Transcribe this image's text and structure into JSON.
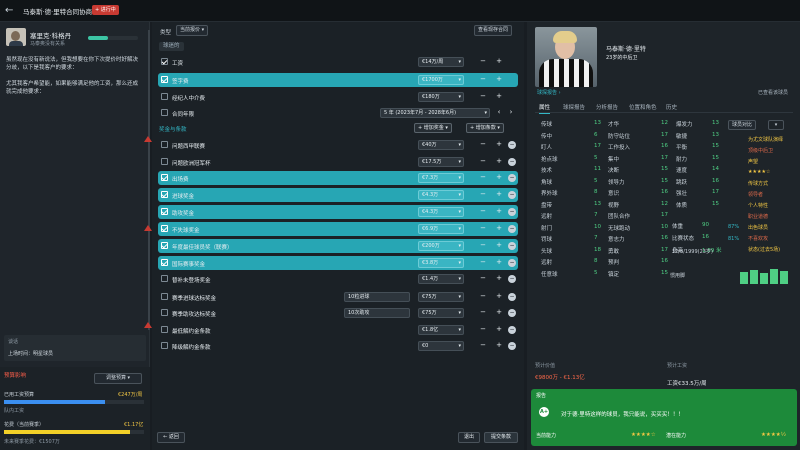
{
  "header": {
    "title": "马泰斯·德·里特合同协商",
    "badge": "+ 进行中"
  },
  "agent": {
    "name": "塞里克·科格丹",
    "subtitle": "马泰奥没有关系",
    "message1": "虽然现在没有新说法，但我想要在你下次提价时好解决分歧，以下是我客户的要求：",
    "message2": "尤其我客户希望能，如果能够满足他的工资，那么还成就完成他要求：",
    "box_title": "谈话",
    "box_text": "上场时间：明星球员"
  },
  "budget": {
    "title": "预算影响",
    "adjust_label": "调整预算",
    "wage_label": "已用工资预算",
    "wage_value": "€247万/周",
    "wage_sub": "队内工资",
    "wage_fill": 0.72,
    "spend_label": "花费（当前赛季）",
    "spend_value": "€1.17亿",
    "spend_sub": "未来赛季花费：€1507万",
    "spend_fill": 0.9
  },
  "center": {
    "type_label": "类型",
    "type_value": "当前报价",
    "view_btn": "查看现存合同",
    "status": "球迷的",
    "bonus_section": "奖金与条款",
    "add_bonus": "增加奖金",
    "add_clause": "增加条款",
    "rows": [
      {
        "label": "工资",
        "value": "€14万/周",
        "hl": false,
        "checked": true
      },
      {
        "label": "签字费",
        "value": "€1700万",
        "hl": true,
        "checked": true
      },
      {
        "label": "经纪人中介费",
        "value": "€180万",
        "hl": false,
        "checked": false
      },
      {
        "label": "合同年限",
        "value": "5 年 (2023年7月 - 2028年6月)",
        "hl": false,
        "checked": false
      },
      {
        "label": "问题西甲联赛",
        "value": "€40万",
        "hl": false,
        "checked": false
      },
      {
        "label": "问题欧洲冠军杯",
        "value": "€17.5万",
        "hl": false,
        "checked": false
      },
      {
        "label": "出场费",
        "value": "€7.3万",
        "hl": true,
        "checked": true
      },
      {
        "label": "进球奖金",
        "value": "€4.3万",
        "hl": true,
        "checked": true
      },
      {
        "label": "助攻奖金",
        "value": "€4.3万",
        "hl": true,
        "checked": true
      },
      {
        "label": "不失球奖金",
        "value": "€6.9万",
        "hl": true,
        "checked": true
      },
      {
        "label": "年度最佳球员奖（联赛）",
        "value": "€200万",
        "hl": true,
        "checked": true
      },
      {
        "label": "国际赛事奖金",
        "value": "€3.8万",
        "hl": true,
        "checked": true
      },
      {
        "label": "替补未登场奖金",
        "value": "€1.4万",
        "hl": false,
        "checked": false
      },
      {
        "label": "赛季进球达标奖金",
        "value": "€75万",
        "hl": false,
        "checked": false,
        "cond": "10粒进球"
      },
      {
        "label": "赛季助攻达标奖金",
        "value": "€75万",
        "hl": false,
        "checked": false,
        "cond": "10次助攻"
      },
      {
        "label": "最低解约金条款",
        "value": "€1.8亿",
        "hl": false,
        "checked": false
      },
      {
        "label": "降级解约金条款",
        "value": "€0",
        "hl": false,
        "checked": false
      }
    ],
    "back_btn": "返回",
    "leave_btn": "退出",
    "propose_btn": "提交条款"
  },
  "player": {
    "name": "马泰斯·德·里特",
    "sub": "23岁的中后卫",
    "report_link": "球探报告 ›",
    "tabs": [
      "属性",
      "球探报告",
      "分析报告",
      "位置和角色",
      "历史"
    ],
    "compare": "已查看该球员",
    "attrs": [
      [
        "传球",
        "13"
      ],
      [
        "传中",
        "6"
      ],
      [
        "盯人",
        "17"
      ],
      [
        "抢点球",
        "5"
      ],
      [
        "技术",
        "11"
      ],
      [
        "角球",
        "5"
      ],
      [
        "界外球",
        "8"
      ],
      [
        "盘带",
        "13"
      ],
      [
        "远射",
        "7"
      ],
      [
        "射门",
        "10"
      ],
      [
        "罚球",
        "7"
      ],
      [
        "头球",
        "18"
      ],
      [
        "远射",
        "8"
      ],
      [
        "任意球",
        "5"
      ]
    ],
    "attrs2": [
      [
        "才华",
        "12"
      ],
      [
        "防守站位",
        "17"
      ],
      [
        "工作投入",
        "16"
      ],
      [
        "集中",
        "17"
      ],
      [
        "决断",
        "15"
      ],
      [
        "领导力",
        "15"
      ],
      [
        "意识",
        "16"
      ],
      [
        "视野",
        "12"
      ],
      [
        "团队合作",
        "17"
      ],
      [
        "无球跑动",
        "10"
      ],
      [
        "意志力",
        "16"
      ],
      [
        "勇敢",
        "17"
      ],
      [
        "预判",
        "16"
      ],
      [
        "镇定",
        "15"
      ]
    ],
    "attrs3": [
      [
        "爆发力",
        "13"
      ],
      [
        "敏捷",
        "13"
      ],
      [
        "平衡",
        "15"
      ],
      [
        "耐力",
        "15"
      ],
      [
        "速度",
        "14"
      ],
      [
        "跳跃",
        "16"
      ],
      [
        "强壮",
        "17"
      ],
      [
        "体质",
        "15"
      ]
    ],
    "phys": [
      [
        "体重",
        "90"
      ],
      [
        "比赛状态",
        "16"
      ],
      [
        "身高",
        "1.89 米"
      ]
    ],
    "dob": "12/8/1999(23岁)",
    "foot_label": "惯用脚",
    "role": "球员对比",
    "roles": [
      "为尤文球队演绎",
      "顶级中后卫",
      "声望",
      "★★★★☆",
      "传球方式",
      "领导者",
      "个人特性",
      "职业道德",
      "出色球员",
      "不喜欢攻",
      "状态(过去5场)"
    ],
    "pct1": "87%",
    "pct2": "81%",
    "value_label": "预计价值",
    "value": "€9800万 - €1.13亿",
    "wage_label": "预计工资",
    "wage": "工资€33.5万/周",
    "report_title": "报告",
    "report_text": "对于德·里特这样的球员，我只能说，买买买！！！",
    "current": "当前能力",
    "potential": "潜在能力",
    "stars1": "★★★★☆",
    "stars2": "★★★★½"
  }
}
